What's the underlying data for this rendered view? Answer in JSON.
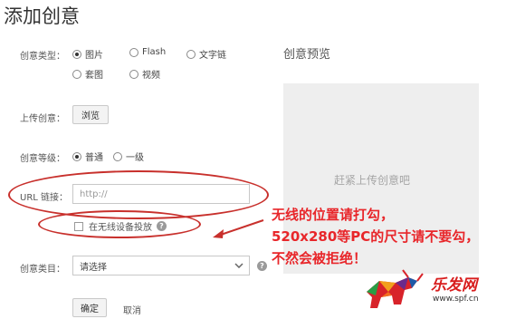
{
  "page": {
    "title": "添加创意"
  },
  "form": {
    "type": {
      "label": "创意类型：",
      "options": [
        {
          "label": "图片",
          "selected": true
        },
        {
          "label": "Flash",
          "selected": false
        },
        {
          "label": "文字链",
          "selected": false
        },
        {
          "label": "套图",
          "selected": false
        },
        {
          "label": "视频",
          "selected": false
        }
      ]
    },
    "upload": {
      "label": "上传创意：",
      "button_label": "浏览"
    },
    "level": {
      "label": "创意等级：",
      "options": [
        {
          "label": "普通",
          "selected": true
        },
        {
          "label": "一级",
          "selected": false
        }
      ]
    },
    "url": {
      "label": "URL 链接：",
      "placeholder": "http://"
    },
    "wireless": {
      "label": "在无线设备投放",
      "checked": false
    },
    "category": {
      "label": "创意类目：",
      "value": "请选择"
    },
    "actions": {
      "confirm_label": "确定",
      "cancel_label": "取消"
    }
  },
  "preview": {
    "title": "创意预览",
    "empty_text": "赶紧上传创意吧"
  },
  "annotation": {
    "lines": [
      "无线的位置请打勾，",
      "520x280等PC的尺寸请不要勾，",
      "不然会被拒绝！"
    ],
    "color": "#e8262a"
  },
  "watermark": {
    "logo_text": "乐发网",
    "url": "www.spf.cn"
  },
  "colors": {
    "ellipse": "#c8302c",
    "preview_bg": "#eeeeee",
    "annotation": "#e8262a"
  }
}
